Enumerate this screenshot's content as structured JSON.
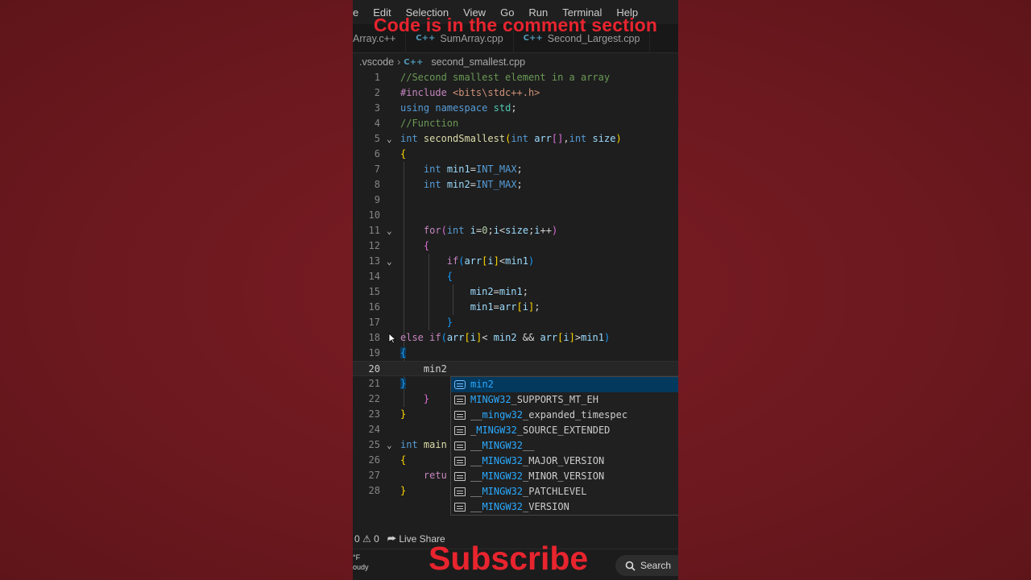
{
  "overlay": {
    "top_caption": "Code is in the comment section",
    "subscribe": "Subscribe"
  },
  "menu": [
    "e",
    "Edit",
    "Selection",
    "View",
    "Go",
    "Run",
    "Terminal",
    "Help"
  ],
  "tabs": [
    {
      "label": "Array.c++",
      "icon": "cpp-icon"
    },
    {
      "label": "SumArray.cpp",
      "icon": "cpp-icon"
    },
    {
      "label": "Second_Largest.cpp",
      "icon": "cpp-icon"
    }
  ],
  "breadcrumb": {
    "folder": ".vscode",
    "file": "second_smallest.cpp"
  },
  "editor": {
    "active_line": "20",
    "line_numbers": [
      "1",
      "2",
      "3",
      "4",
      "5",
      "6",
      "7",
      "8",
      "9",
      "10",
      "11",
      "12",
      "13",
      "14",
      "15",
      "16",
      "17",
      "18",
      "19",
      "20",
      "21",
      "22",
      "23",
      "24",
      "25",
      "26",
      "27",
      "28"
    ]
  },
  "suggestions": [
    {
      "label": "min2",
      "kind": "variable",
      "icon": "variable-icon",
      "match": "min2",
      "rest": ""
    },
    {
      "label": "MINGW32_SUPPORTS_MT_EH",
      "kind": "macro",
      "icon": "text-icon",
      "pre": "",
      "match": "MINGW32",
      "rest": "_SUPPORTS_MT_EH"
    },
    {
      "label": "__mingw32_expanded_timespec",
      "kind": "struct",
      "icon": "struct-icon",
      "pre": "__",
      "match": "mingw32",
      "rest": "_expanded_timespec"
    },
    {
      "label": "_MINGW32_SOURCE_EXTENDED",
      "kind": "macro",
      "icon": "text-icon",
      "pre": "_",
      "match": "MINGW32",
      "rest": "_SOURCE_EXTENDED"
    },
    {
      "label": "__MINGW32__",
      "kind": "macro",
      "icon": "text-icon",
      "pre": "__",
      "match": "MINGW32",
      "rest": "__"
    },
    {
      "label": "__MINGW32_MAJOR_VERSION",
      "kind": "macro",
      "icon": "text-icon",
      "pre": "__",
      "match": "MINGW32",
      "rest": "_MAJOR_VERSION"
    },
    {
      "label": "__MINGW32_MINOR_VERSION",
      "kind": "macro",
      "icon": "text-icon",
      "pre": "__",
      "match": "MINGW32",
      "rest": "_MINOR_VERSION"
    },
    {
      "label": "__MINGW32_PATCHLEVEL",
      "kind": "macro",
      "icon": "text-icon",
      "pre": "__",
      "match": "MINGW32",
      "rest": "_PATCHLEVEL"
    },
    {
      "label": "__MINGW32_VERSION",
      "kind": "macro",
      "icon": "text-icon",
      "pre": "__",
      "match": "MINGW32",
      "rest": "_VERSION"
    }
  ],
  "statusbar": {
    "errors": "0",
    "warnings": "0",
    "live_share": "Live Share"
  },
  "taskbar": {
    "weather_line1": "°F",
    "weather_line2": "oudy",
    "search": "Search"
  },
  "colors": {
    "accent": "#e8242e",
    "background": "#6e1a20",
    "editor_bg": "#1e1e1e"
  }
}
